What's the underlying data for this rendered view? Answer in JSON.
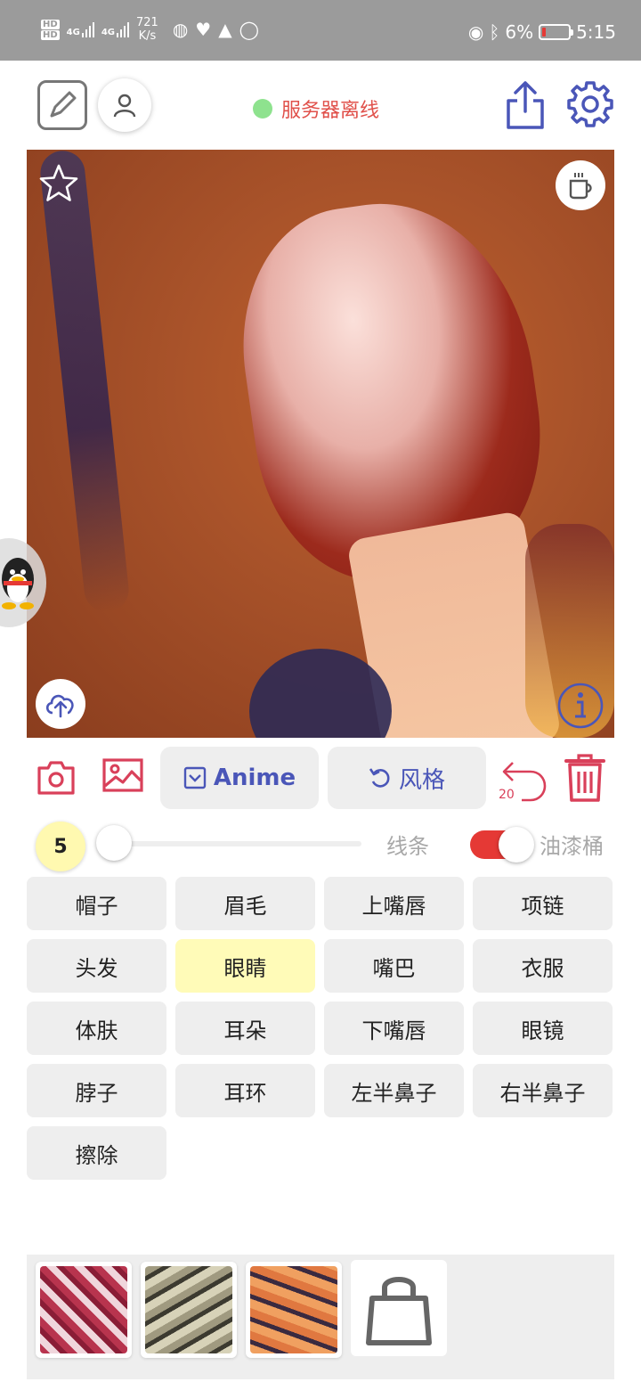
{
  "status_bar": {
    "hd1": "HD",
    "hd2": "HD",
    "net1": "4G",
    "net2": "4G",
    "speed_value": "721",
    "speed_unit": "K/s",
    "battery_percent": "6%",
    "time": "5:15"
  },
  "toolbar": {
    "server_status": "服务器离线"
  },
  "toolrow": {
    "anime_label": "Anime",
    "style_label": "风格",
    "undo_count": "20"
  },
  "brush": {
    "size": "5",
    "line_label": "线条",
    "bucket_label": "油漆桶",
    "bucket_enabled": true
  },
  "parts": [
    "帽子",
    "眉毛",
    "上嘴唇",
    "项链",
    "头发",
    "眼睛",
    "嘴巴",
    "衣服",
    "体肤",
    "耳朵",
    "下嘴唇",
    "眼镜",
    "脖子",
    "耳环",
    "左半鼻子",
    "右半鼻子",
    "擦除"
  ],
  "selected_part": "眼睛",
  "colors": {
    "accent": "#4a56b8",
    "danger": "#d9405a",
    "server_offline_text": "#e0504a",
    "server_dot": "#8ee28e",
    "selected_part_bg": "#fffbb8"
  }
}
